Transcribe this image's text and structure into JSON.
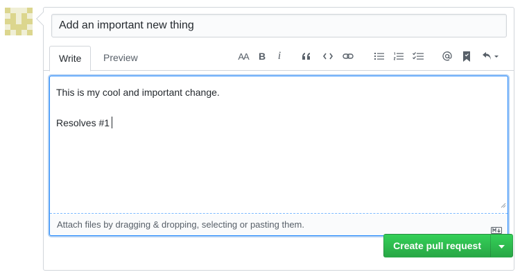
{
  "title_input": {
    "value": "Add an important new thing"
  },
  "tabs": [
    {
      "label": "Write"
    },
    {
      "label": "Preview"
    }
  ],
  "toolbar": {
    "heading_glyph": "AA",
    "bold_glyph": "B",
    "italic_glyph": "i",
    "icons": [
      "text-size-icon",
      "bold-icon",
      "italic-icon",
      "quote-icon",
      "code-icon",
      "link-icon",
      "unordered-list-icon",
      "ordered-list-icon",
      "task-list-icon",
      "mention-icon",
      "reference-icon",
      "reply-icon"
    ]
  },
  "editor": {
    "line1": "This is my cool and important change.",
    "line2": "",
    "line3": "Resolves #1",
    "attach_text": "Attach files by dragging & dropping, selecting or pasting them."
  },
  "buttons": {
    "create_label": "Create pull request"
  },
  "colors": {
    "accent_green": "#28a745",
    "focus_blue": "#2188ff",
    "avatar": "#e1dc9a"
  }
}
